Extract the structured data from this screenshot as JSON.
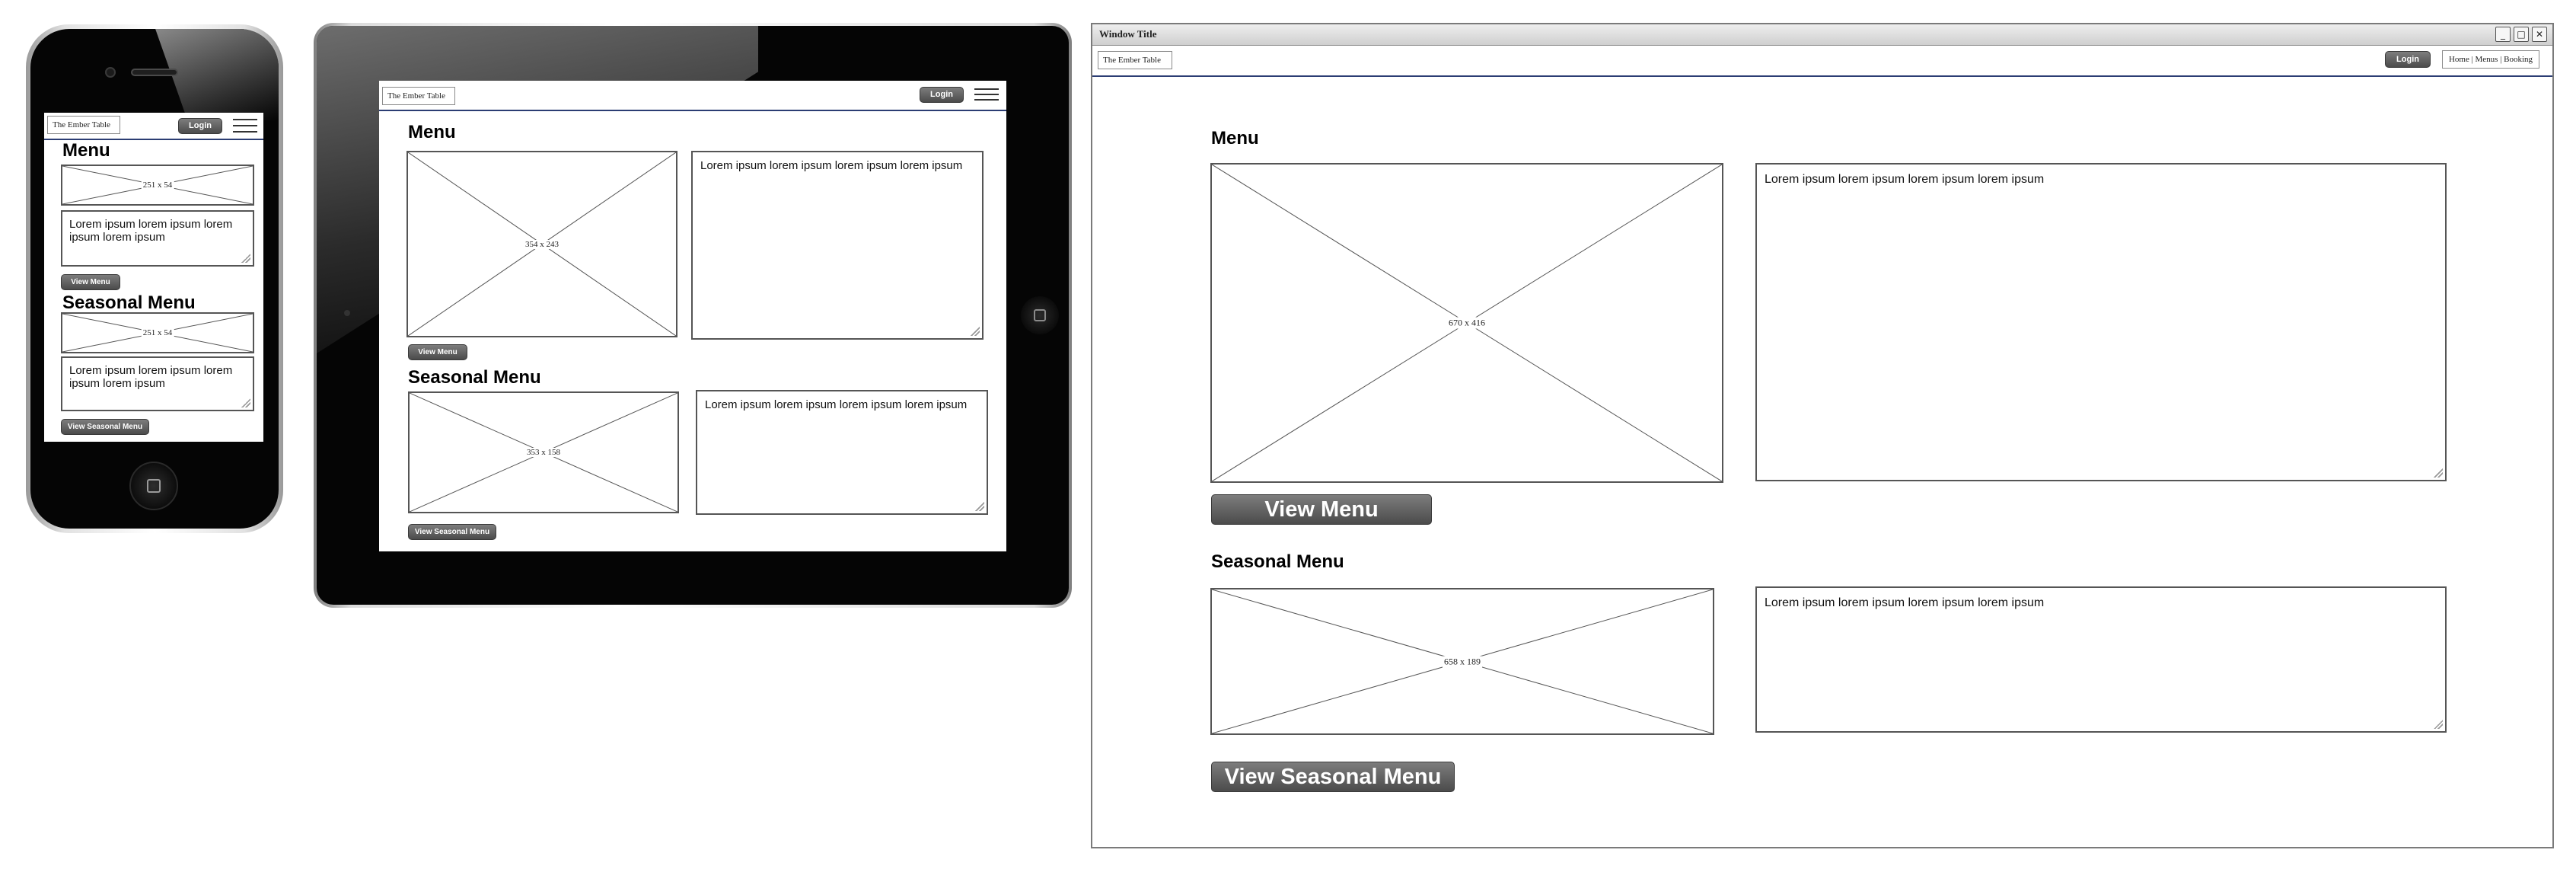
{
  "window": {
    "title": "Window Title",
    "controls": [
      "_",
      "□",
      "✕"
    ]
  },
  "brand": "The Ember Table",
  "login_label": "Login",
  "nav_links": "Home | Menus | Booking",
  "menu_heading": "Menu",
  "seasonal_heading": "Seasonal Menu",
  "view_menu_label": "View Menu",
  "view_seasonal_label": "View Seasonal Menu",
  "lorem": "Lorem ipsum lorem ipsum lorem ipsum lorem ipsum",
  "phone": {
    "menu_image_size": "251 x 54",
    "seasonal_image_size": "251 x 54"
  },
  "tablet": {
    "menu_image_size": "354 x 243",
    "seasonal_image_size": "353 x 158"
  },
  "desktop": {
    "menu_image_size": "670 x 416",
    "seasonal_image_size": "658 x 189"
  },
  "colors": {
    "header_rule": "#2b3d73",
    "button": "#5c5c5c",
    "device_frame": "#050505"
  }
}
